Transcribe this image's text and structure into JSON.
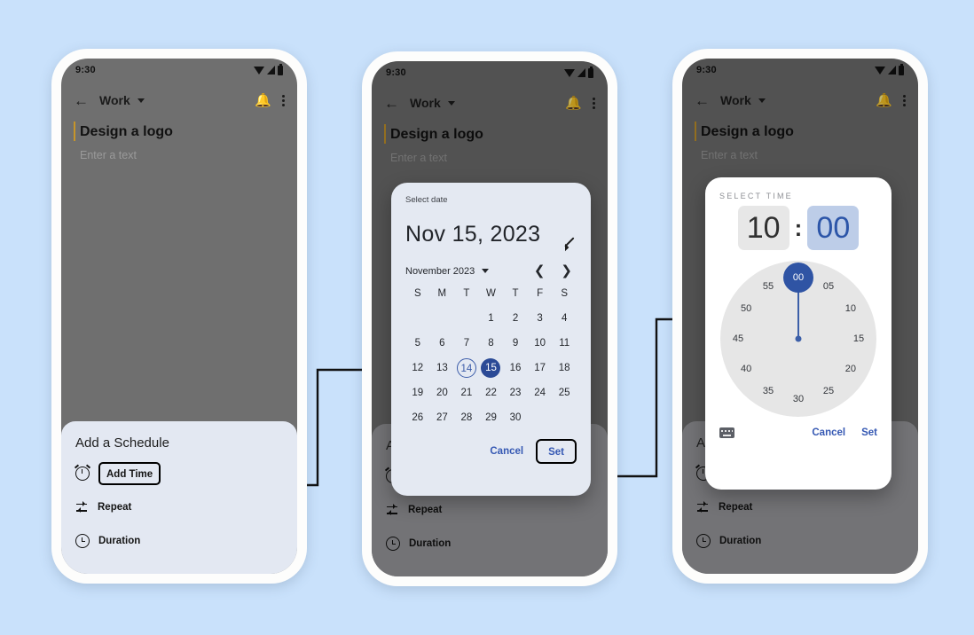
{
  "background_color": "#c9e1fb",
  "accent_color": "#2b4a96",
  "link_color": "#3558b3",
  "app": {
    "status_bar": {
      "time": "9:30",
      "icons": [
        "wifi-icon",
        "signal-icon",
        "battery-icon"
      ]
    },
    "app_bar": {
      "back_icon": "back-arrow-icon",
      "title": "Work",
      "dropdown_icon": "chevron-down-icon",
      "notification_icon": "add-alarm-bell-icon",
      "overflow_icon": "more-vertical-icon"
    },
    "content": {
      "task_title": "Design a logo",
      "note_placeholder": "Enter a text"
    },
    "sheet": {
      "title": "Add a Schedule",
      "rows": [
        {
          "icon": "alarm-clock-icon",
          "label": "Add Time",
          "highlighted": true
        },
        {
          "icon": "repeat-icon",
          "label": "Repeat",
          "highlighted": false
        },
        {
          "icon": "clock-icon",
          "label": "Duration",
          "highlighted": false
        }
      ]
    }
  },
  "date_dialog": {
    "label": "Select date",
    "headline": "Nov 15, 2023",
    "edit_icon": "pencil-icon",
    "month_label": "November 2023",
    "month_dropdown_icon": "chevron-down-icon",
    "prev_icon": "chevron-left-icon",
    "next_icon": "chevron-right-icon",
    "weekdays": [
      "S",
      "M",
      "T",
      "W",
      "T",
      "F",
      "S"
    ],
    "weeks": [
      [
        null,
        null,
        null,
        {
          "d": "1",
          "s": "disabled"
        },
        {
          "d": "2",
          "s": "disabled"
        },
        {
          "d": "3",
          "s": "disabled"
        },
        {
          "d": "4",
          "s": "disabled"
        }
      ],
      [
        {
          "d": "5",
          "s": "disabled"
        },
        {
          "d": "6",
          "s": "disabled"
        },
        {
          "d": "7",
          "s": "disabled"
        },
        {
          "d": "8",
          "s": "disabled"
        },
        {
          "d": "9",
          "s": "disabled"
        },
        {
          "d": "10",
          "s": "disabled"
        },
        {
          "d": "11",
          "s": "disabled"
        }
      ],
      [
        {
          "d": "12",
          "s": "disabled"
        },
        {
          "d": "13",
          "s": "disabled"
        },
        {
          "d": "14",
          "s": "today"
        },
        {
          "d": "15",
          "s": "selected"
        },
        {
          "d": "16",
          "s": "normal"
        },
        {
          "d": "17",
          "s": "normal"
        },
        {
          "d": "18",
          "s": "normal"
        }
      ],
      [
        {
          "d": "19",
          "s": "normal"
        },
        {
          "d": "20",
          "s": "normal"
        },
        {
          "d": "21",
          "s": "normal"
        },
        {
          "d": "22",
          "s": "normal"
        },
        {
          "d": "23",
          "s": "normal"
        },
        {
          "d": "24",
          "s": "normal"
        },
        {
          "d": "25",
          "s": "normal"
        }
      ],
      [
        {
          "d": "26",
          "s": "normal"
        },
        {
          "d": "27",
          "s": "normal"
        },
        {
          "d": "28",
          "s": "normal"
        },
        {
          "d": "29",
          "s": "normal"
        },
        {
          "d": "30",
          "s": "normal"
        },
        null,
        null
      ]
    ],
    "cancel_label": "Cancel",
    "set_label": "Set"
  },
  "time_dialog": {
    "label": "SELECT TIME",
    "hour": "10",
    "separator": ":",
    "minute": "00",
    "active_field": "minute",
    "clock_mode": "minutes",
    "clock_numbers": [
      "00",
      "05",
      "10",
      "15",
      "20",
      "25",
      "30",
      "35",
      "40",
      "45",
      "50",
      "55"
    ],
    "selected_value": "00",
    "keyboard_icon": "keyboard-icon",
    "cancel_label": "Cancel",
    "set_label": "Set"
  }
}
